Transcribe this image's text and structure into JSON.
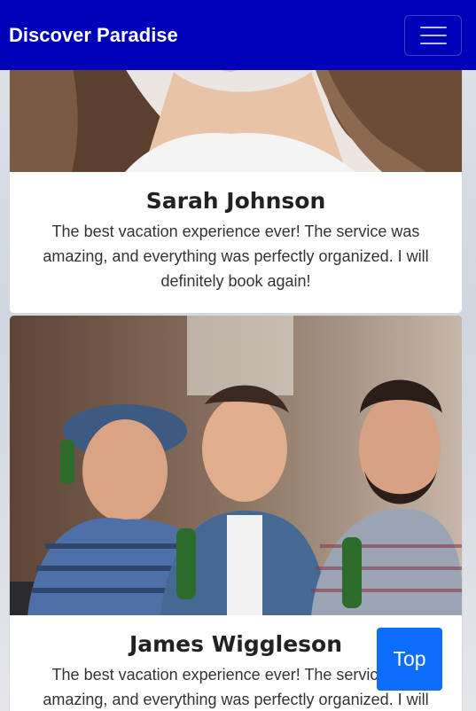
{
  "navbar": {
    "brand": "Discover Paradise",
    "menu_icon": "hamburger-icon"
  },
  "testimonials": [
    {
      "name": "Sarah Johnson",
      "quote": "The best vacation experience ever! The service was amazing, and everything was perfectly organized. I will definitely book again!"
    },
    {
      "name": "James Wiggleson",
      "quote": "The best vacation experience ever! The service was amazing, and everything was perfectly organized. I will definitely book again!"
    }
  ],
  "scroll_top": {
    "label": "Top"
  },
  "colors": {
    "navbar": "#0000b8",
    "top_button": "#0d6efd"
  }
}
